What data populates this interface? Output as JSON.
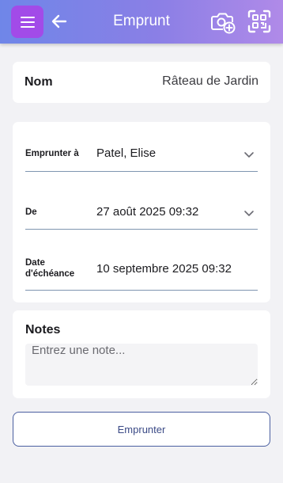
{
  "header": {
    "title": "Emprunt",
    "menu_icon": "hamburger-menu-icon",
    "back_icon": "arrow-left-icon",
    "camera_icon": "camera-add-icon",
    "scan_icon": "qr-scan-icon",
    "menu_bg": "#a24be8"
  },
  "item": {
    "label": "Nom",
    "value": "Râteau de Jardin"
  },
  "fields": [
    {
      "label": "Emprunter à",
      "value": "Patel, Elise",
      "has_dropdown": true
    },
    {
      "label": "De",
      "value": "27 août 2025 09:32",
      "has_dropdown": true
    },
    {
      "label": "Date d'échéance",
      "value": "10 septembre 2025 09:32",
      "has_dropdown": false
    }
  ],
  "notes": {
    "title": "Notes",
    "placeholder": "Entrez une note...",
    "value": ""
  },
  "actions": {
    "borrow_label": "Emprunter"
  },
  "colors": {
    "accent": "#a24be8",
    "button_border": "#4b5fa0",
    "underline": "#7f95b0",
    "background": "#f2f2f5"
  }
}
